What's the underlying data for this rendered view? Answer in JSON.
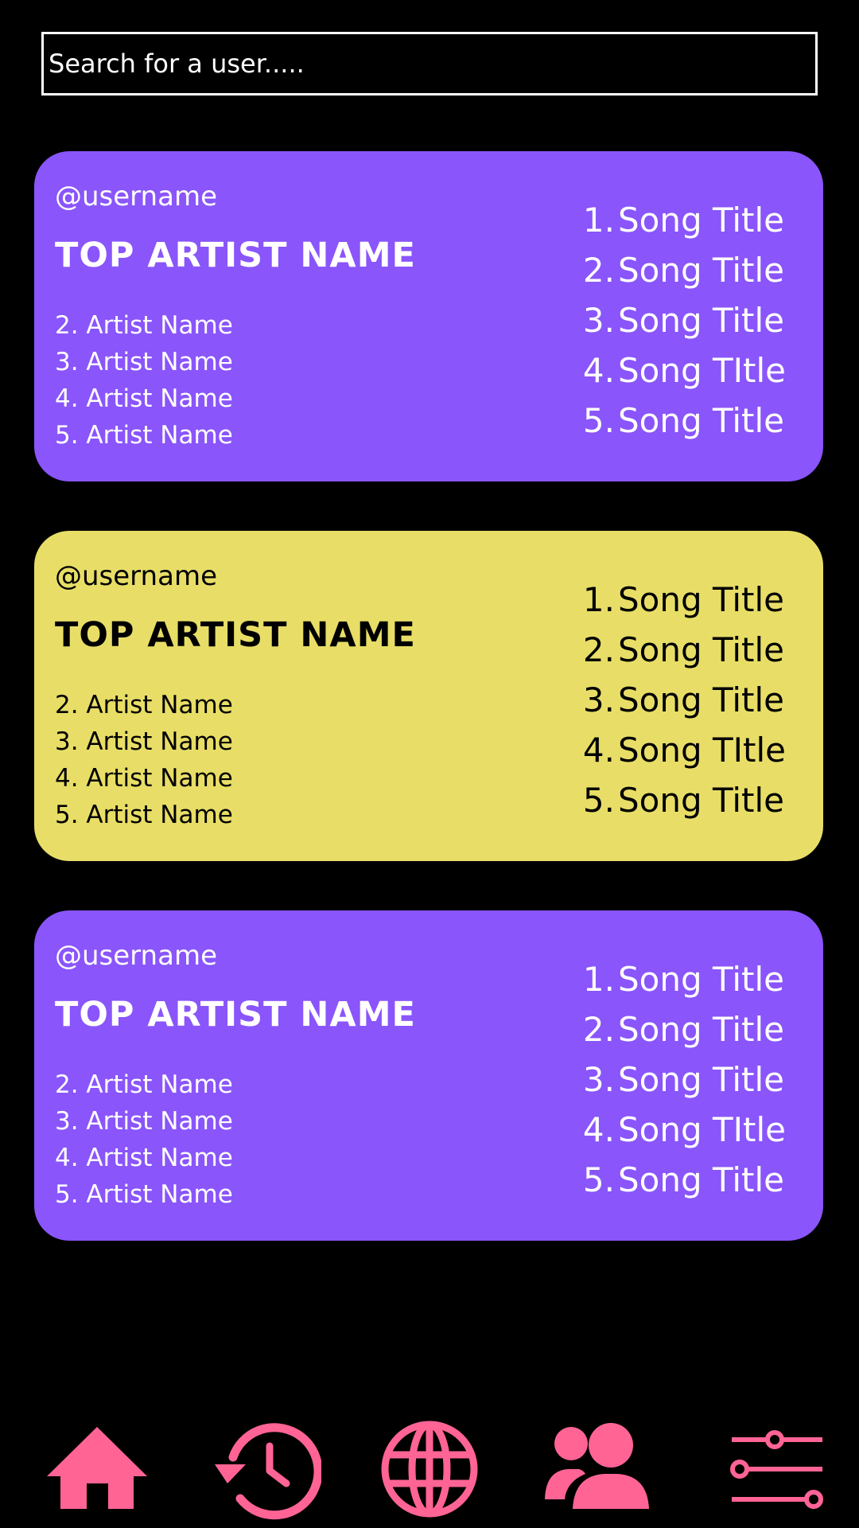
{
  "search": {
    "placeholder": "Search for a user....."
  },
  "cards": [
    {
      "theme": "purple",
      "username": "@username",
      "top_artist": "TOP ARTIST NAME",
      "artists": [
        "2. Artist Name",
        "3. Artist Name",
        "4. Artist Name",
        "5. Artist Name"
      ],
      "songs": [
        {
          "num": "1.",
          "title": "Song Title"
        },
        {
          "num": "2.",
          "title": "Song Title"
        },
        {
          "num": "3.",
          "title": "Song Title"
        },
        {
          "num": "4.",
          "title": "Song TItle"
        },
        {
          "num": "5.",
          "title": "Song Title"
        }
      ]
    },
    {
      "theme": "yellow",
      "username": "@username",
      "top_artist": "TOP ARTIST NAME",
      "artists": [
        "2. Artist Name",
        "3. Artist Name",
        "4. Artist Name",
        "5. Artist Name"
      ],
      "songs": [
        {
          "num": "1.",
          "title": "Song Title"
        },
        {
          "num": "2.",
          "title": "Song Title"
        },
        {
          "num": "3.",
          "title": "Song Title"
        },
        {
          "num": "4.",
          "title": "Song TItle"
        },
        {
          "num": "5.",
          "title": "Song Title"
        }
      ]
    },
    {
      "theme": "purple",
      "username": "@username",
      "top_artist": "TOP ARTIST NAME",
      "artists": [
        "2. Artist Name",
        "3. Artist Name",
        "4. Artist Name",
        "5. Artist Name"
      ],
      "songs": [
        {
          "num": "1.",
          "title": "Song Title"
        },
        {
          "num": "2.",
          "title": "Song Title"
        },
        {
          "num": "3.",
          "title": "Song Title"
        },
        {
          "num": "4.",
          "title": "Song TItle"
        },
        {
          "num": "5.",
          "title": "Song Title"
        }
      ]
    }
  ],
  "nav": [
    {
      "icon": "home-icon"
    },
    {
      "icon": "history-icon"
    },
    {
      "icon": "globe-icon"
    },
    {
      "icon": "friends-icon"
    },
    {
      "icon": "settings-sliders-icon"
    }
  ],
  "colors": {
    "background": "#000000",
    "card_purple": "#8a55fb",
    "card_yellow": "#e8de67",
    "nav_accent": "#ff6495"
  }
}
